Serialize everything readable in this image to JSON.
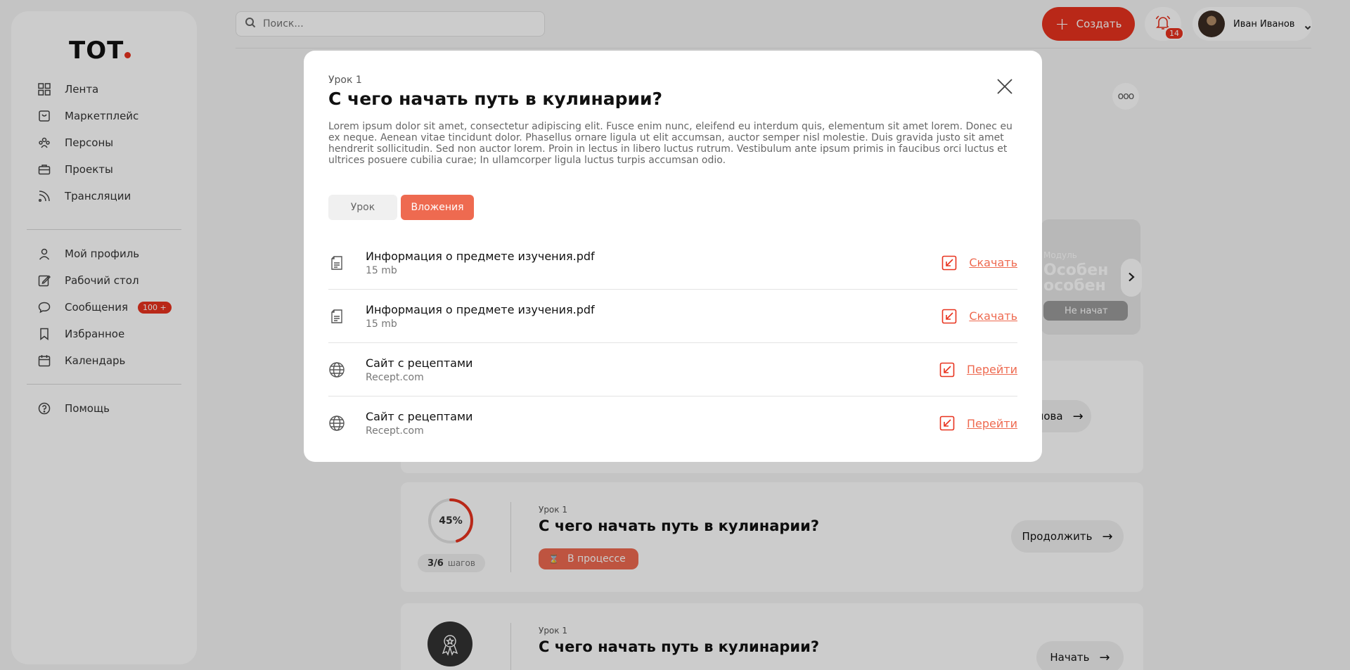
{
  "brand": {
    "logo_text": "ТОТ"
  },
  "sidebar": {
    "groups": [
      [
        {
          "label": "Лента",
          "icon": "grid-icon"
        },
        {
          "label": "Маркетплейс",
          "icon": "bag-icon"
        },
        {
          "label": "Персоны",
          "icon": "people-icon"
        },
        {
          "label": "Проекты",
          "icon": "briefcase-icon"
        },
        {
          "label": "Трансляции",
          "icon": "broadcast-icon"
        }
      ],
      [
        {
          "label": "Мой профиль",
          "icon": "user-icon"
        },
        {
          "label": "Рабочий стол",
          "icon": "edit-icon"
        },
        {
          "label": "Сообщения",
          "icon": "chat-icon",
          "badge": "100 +"
        },
        {
          "label": "Избранное",
          "icon": "bookmark-icon"
        },
        {
          "label": "Календарь",
          "icon": "calendar-icon"
        }
      ],
      [
        {
          "label": "Помощь",
          "icon": "help-icon"
        }
      ]
    ]
  },
  "header": {
    "search_placeholder": "Поиск...",
    "create_label": "Создать",
    "notifications_count": "14",
    "user_name": "Иван Иванов"
  },
  "background": {
    "module_card": {
      "label": "Модуль",
      "title_line1": "Особен",
      "title_line2": "особен",
      "status": "Не начат"
    },
    "lesson_cards": [
      {
        "button": "Пройти снова"
      },
      {
        "label": "Урок 1",
        "title": "С чего начать путь в кулинарии?",
        "progress_percent": 45,
        "progress_text": "45%",
        "steps": "3/6",
        "steps_unit": "шагов",
        "status": "В процессе",
        "button": "Продолжить"
      },
      {
        "label": "Урок 1",
        "title": "С чего начать путь в кулинарии?",
        "button": "Начать"
      }
    ]
  },
  "modal": {
    "label": "Урок 1",
    "title": "С чего начать путь в кулинарии?",
    "description": "Lorem ipsum dolor sit amet, consectetur adipiscing elit. Fusce enim nunc, eleifend eu interdum quis, elementum sit amet lorem. Donec eu ex neque. Aenean vitae tincidunt dolor. Phasellus ornare ligula ut elit accumsan, auctor semper nisl molestie. Duis gravida justo sit amet hendrerit sollicitudin. Sed non auctor lorem. Proin in lectus in libero luctus rutrum. Vestibulum ante ipsum primis in faucibus orci luctus et ultrices posuere cubilia curae; In ullamcorper ligula luctus turpis accumsan odio.",
    "tabs": [
      {
        "label": "Урок",
        "active": false
      },
      {
        "label": "Вложения",
        "active": true
      }
    ],
    "attachments": [
      {
        "type": "file",
        "icon": "document-icon",
        "name": "Информация о предмете изучения.pdf",
        "meta": "15 mb",
        "action": "Скачать"
      },
      {
        "type": "file",
        "icon": "document-icon",
        "name": "Информация о предмете изучения.pdf",
        "meta": "15 mb",
        "action": "Скачать"
      },
      {
        "type": "link",
        "icon": "globe-icon",
        "name": "Сайт с рецептами",
        "meta": "Recept.com",
        "action": "Перейти"
      },
      {
        "type": "link",
        "icon": "globe-icon",
        "name": "Сайт с рецептами",
        "meta": "Recept.com",
        "action": "Перейти"
      }
    ]
  },
  "colors": {
    "accent": "#e8331f",
    "accent_soft": "#ee6a50"
  }
}
